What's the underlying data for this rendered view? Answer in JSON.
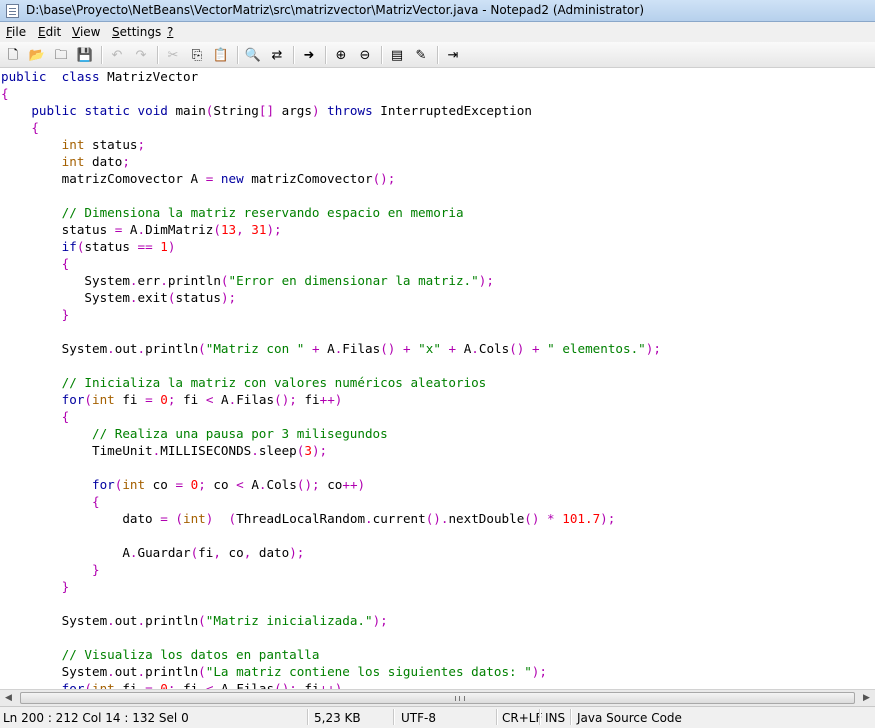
{
  "window": {
    "title": "D:\\base\\Proyecto\\NetBeans\\VectorMatriz\\src\\matrizvector\\MatrizVector.java - Notepad2 (Administrator)"
  },
  "menu": {
    "items": [
      {
        "accel": "F",
        "rest": "ile"
      },
      {
        "accel": "E",
        "rest": "dit"
      },
      {
        "accel": "V",
        "rest": "iew"
      },
      {
        "accel": "S",
        "rest": "ettings"
      },
      {
        "accel": "?",
        "rest": ""
      }
    ]
  },
  "toolbar": {
    "icons": [
      "new-file-icon",
      "open-folder-icon",
      "browse-icon",
      "save-icon",
      "undo-icon",
      "redo-icon",
      "cut-icon",
      "copy-icon",
      "paste-icon",
      "find-icon",
      "replace-icon",
      "goto-icon",
      "zoom-in-icon",
      "zoom-out-icon",
      "select-scheme-icon",
      "customize-scheme-icon",
      "exit-icon"
    ]
  },
  "editor": {
    "lines": [
      [
        [
          "kw",
          "public"
        ],
        [
          "",
          "  "
        ],
        [
          "kw",
          "class"
        ],
        [
          "",
          " MatrizVector"
        ]
      ],
      [
        [
          "op",
          "{"
        ]
      ],
      [
        [
          "",
          "    "
        ],
        [
          "kw",
          "public"
        ],
        [
          "",
          " "
        ],
        [
          "kw",
          "static"
        ],
        [
          "",
          " "
        ],
        [
          "kw",
          "void"
        ],
        [
          "",
          " main"
        ],
        [
          "op",
          "("
        ],
        [
          "",
          "String"
        ],
        [
          "op",
          "[]"
        ],
        [
          "",
          " args"
        ],
        [
          "op",
          ")"
        ],
        [
          "",
          " "
        ],
        [
          "kw",
          "throws"
        ],
        [
          "",
          " InterruptedException"
        ]
      ],
      [
        [
          "",
          "    "
        ],
        [
          "op",
          "{"
        ]
      ],
      [
        [
          "",
          "        "
        ],
        [
          "ty",
          "int"
        ],
        [
          "",
          " status"
        ],
        [
          "op",
          ";"
        ]
      ],
      [
        [
          "",
          "        "
        ],
        [
          "ty",
          "int"
        ],
        [
          "",
          " dato"
        ],
        [
          "op",
          ";"
        ]
      ],
      [
        [
          "",
          "        matrizComovector A "
        ],
        [
          "op",
          "="
        ],
        [
          "",
          " "
        ],
        [
          "kw",
          "new"
        ],
        [
          "",
          " matrizComovector"
        ],
        [
          "op",
          "();"
        ]
      ],
      [],
      [
        [
          "",
          "        "
        ],
        [
          "cm",
          "// Dimensiona la matriz reservando espacio en memoria"
        ]
      ],
      [
        [
          "",
          "        status "
        ],
        [
          "op",
          "="
        ],
        [
          "",
          " A"
        ],
        [
          "op",
          "."
        ],
        [
          "",
          "DimMatriz"
        ],
        [
          "op",
          "("
        ],
        [
          "nu",
          "13"
        ],
        [
          "op",
          ","
        ],
        [
          "",
          " "
        ],
        [
          "nu",
          "31"
        ],
        [
          "op",
          ");"
        ]
      ],
      [
        [
          "",
          "        "
        ],
        [
          "kw",
          "if"
        ],
        [
          "op",
          "("
        ],
        [
          "",
          "status "
        ],
        [
          "op",
          "=="
        ],
        [
          "",
          " "
        ],
        [
          "nu",
          "1"
        ],
        [
          "op",
          ")"
        ]
      ],
      [
        [
          "",
          "        "
        ],
        [
          "op",
          "{"
        ]
      ],
      [
        [
          "",
          "           System"
        ],
        [
          "op",
          "."
        ],
        [
          "",
          "err"
        ],
        [
          "op",
          "."
        ],
        [
          "",
          "println"
        ],
        [
          "op",
          "("
        ],
        [
          "st",
          "\"Error en dimensionar la matriz.\""
        ],
        [
          "op",
          ");"
        ]
      ],
      [
        [
          "",
          "           System"
        ],
        [
          "op",
          "."
        ],
        [
          "",
          "exit"
        ],
        [
          "op",
          "("
        ],
        [
          "",
          "status"
        ],
        [
          "op",
          ");"
        ]
      ],
      [
        [
          "",
          "        "
        ],
        [
          "op",
          "}"
        ]
      ],
      [],
      [
        [
          "",
          "        System"
        ],
        [
          "op",
          "."
        ],
        [
          "",
          "out"
        ],
        [
          "op",
          "."
        ],
        [
          "",
          "println"
        ],
        [
          "op",
          "("
        ],
        [
          "st",
          "\"Matriz con \""
        ],
        [
          "",
          " "
        ],
        [
          "op",
          "+"
        ],
        [
          "",
          " A"
        ],
        [
          "op",
          "."
        ],
        [
          "",
          "Filas"
        ],
        [
          "op",
          "()"
        ],
        [
          "",
          " "
        ],
        [
          "op",
          "+"
        ],
        [
          "",
          " "
        ],
        [
          "st",
          "\"x\""
        ],
        [
          "",
          " "
        ],
        [
          "op",
          "+"
        ],
        [
          "",
          " A"
        ],
        [
          "op",
          "."
        ],
        [
          "",
          "Cols"
        ],
        [
          "op",
          "()"
        ],
        [
          "",
          " "
        ],
        [
          "op",
          "+"
        ],
        [
          "",
          " "
        ],
        [
          "st",
          "\" elementos.\""
        ],
        [
          "op",
          ");"
        ]
      ],
      [],
      [
        [
          "",
          "        "
        ],
        [
          "cm",
          "// Inicializa la matriz con valores numéricos aleatorios"
        ]
      ],
      [
        [
          "",
          "        "
        ],
        [
          "kw",
          "for"
        ],
        [
          "op",
          "("
        ],
        [
          "ty",
          "int"
        ],
        [
          "",
          " fi "
        ],
        [
          "op",
          "="
        ],
        [
          "",
          " "
        ],
        [
          "nu",
          "0"
        ],
        [
          "op",
          ";"
        ],
        [
          "",
          " fi "
        ],
        [
          "op",
          "<"
        ],
        [
          "",
          " A"
        ],
        [
          "op",
          "."
        ],
        [
          "",
          "Filas"
        ],
        [
          "op",
          "();"
        ],
        [
          "",
          " fi"
        ],
        [
          "op",
          "++)"
        ]
      ],
      [
        [
          "",
          "        "
        ],
        [
          "op",
          "{"
        ]
      ],
      [
        [
          "",
          "            "
        ],
        [
          "cm",
          "// Realiza una pausa por 3 milisegundos"
        ]
      ],
      [
        [
          "",
          "            TimeUnit"
        ],
        [
          "op",
          "."
        ],
        [
          "",
          "MILLISECONDS"
        ],
        [
          "op",
          "."
        ],
        [
          "",
          "sleep"
        ],
        [
          "op",
          "("
        ],
        [
          "nu",
          "3"
        ],
        [
          "op",
          ");"
        ]
      ],
      [],
      [
        [
          "",
          "            "
        ],
        [
          "kw",
          "for"
        ],
        [
          "op",
          "("
        ],
        [
          "ty",
          "int"
        ],
        [
          "",
          " co "
        ],
        [
          "op",
          "="
        ],
        [
          "",
          " "
        ],
        [
          "nu",
          "0"
        ],
        [
          "op",
          ";"
        ],
        [
          "",
          " co "
        ],
        [
          "op",
          "<"
        ],
        [
          "",
          " A"
        ],
        [
          "op",
          "."
        ],
        [
          "",
          "Cols"
        ],
        [
          "op",
          "();"
        ],
        [
          "",
          " co"
        ],
        [
          "op",
          "++)"
        ]
      ],
      [
        [
          "",
          "            "
        ],
        [
          "op",
          "{"
        ]
      ],
      [
        [
          "",
          "                dato "
        ],
        [
          "op",
          "="
        ],
        [
          "",
          " "
        ],
        [
          "op",
          "("
        ],
        [
          "ty",
          "int"
        ],
        [
          "op",
          ")"
        ],
        [
          "",
          "  "
        ],
        [
          "op",
          "("
        ],
        [
          "",
          "ThreadLocalRandom"
        ],
        [
          "op",
          "."
        ],
        [
          "",
          "current"
        ],
        [
          "op",
          "()."
        ],
        [
          "",
          "nextDouble"
        ],
        [
          "op",
          "()"
        ],
        [
          "",
          " "
        ],
        [
          "op",
          "*"
        ],
        [
          "",
          " "
        ],
        [
          "nu",
          "101.7"
        ],
        [
          "op",
          ");"
        ]
      ],
      [],
      [
        [
          "",
          "                A"
        ],
        [
          "op",
          "."
        ],
        [
          "",
          "Guardar"
        ],
        [
          "op",
          "("
        ],
        [
          "",
          "fi"
        ],
        [
          "op",
          ","
        ],
        [
          "",
          " co"
        ],
        [
          "op",
          ","
        ],
        [
          "",
          " dato"
        ],
        [
          "op",
          ");"
        ]
      ],
      [
        [
          "",
          "            "
        ],
        [
          "op",
          "}"
        ]
      ],
      [
        [
          "",
          "        "
        ],
        [
          "op",
          "}"
        ]
      ],
      [],
      [
        [
          "",
          "        System"
        ],
        [
          "op",
          "."
        ],
        [
          "",
          "out"
        ],
        [
          "op",
          "."
        ],
        [
          "",
          "println"
        ],
        [
          "op",
          "("
        ],
        [
          "st",
          "\"Matriz inicializada.\""
        ],
        [
          "op",
          ");"
        ]
      ],
      [],
      [
        [
          "",
          "        "
        ],
        [
          "cm",
          "// Visualiza los datos en pantalla"
        ]
      ],
      [
        [
          "",
          "        System"
        ],
        [
          "op",
          "."
        ],
        [
          "",
          "out"
        ],
        [
          "op",
          "."
        ],
        [
          "",
          "println"
        ],
        [
          "op",
          "("
        ],
        [
          "st",
          "\"La matriz contiene los siguientes datos: \""
        ],
        [
          "op",
          ");"
        ]
      ],
      [
        [
          "",
          "        "
        ],
        [
          "kw",
          "for"
        ],
        [
          "op",
          "("
        ],
        [
          "ty",
          "int"
        ],
        [
          "",
          " fi "
        ],
        [
          "op",
          "="
        ],
        [
          "",
          " "
        ],
        [
          "nu",
          "0"
        ],
        [
          "op",
          ";"
        ],
        [
          "",
          " fi "
        ],
        [
          "op",
          "<"
        ],
        [
          "",
          " A"
        ],
        [
          "op",
          "."
        ],
        [
          "",
          "Filas"
        ],
        [
          "op",
          "();"
        ],
        [
          "",
          " fi"
        ],
        [
          "op",
          "++)"
        ]
      ]
    ]
  },
  "status": {
    "position": "Ln 200 : 212   Col 14 : 132   Sel 0",
    "size": "5,23 KB",
    "encoding": "UTF-8",
    "eol": "CR+LF",
    "mode": "INS",
    "scheme": "Java Source Code"
  },
  "colors": {
    "keyword": "#0000a0",
    "type": "#a46000",
    "comment": "#008000",
    "string": "#008000",
    "number": "#ff0000",
    "operator": "#b000b0"
  }
}
